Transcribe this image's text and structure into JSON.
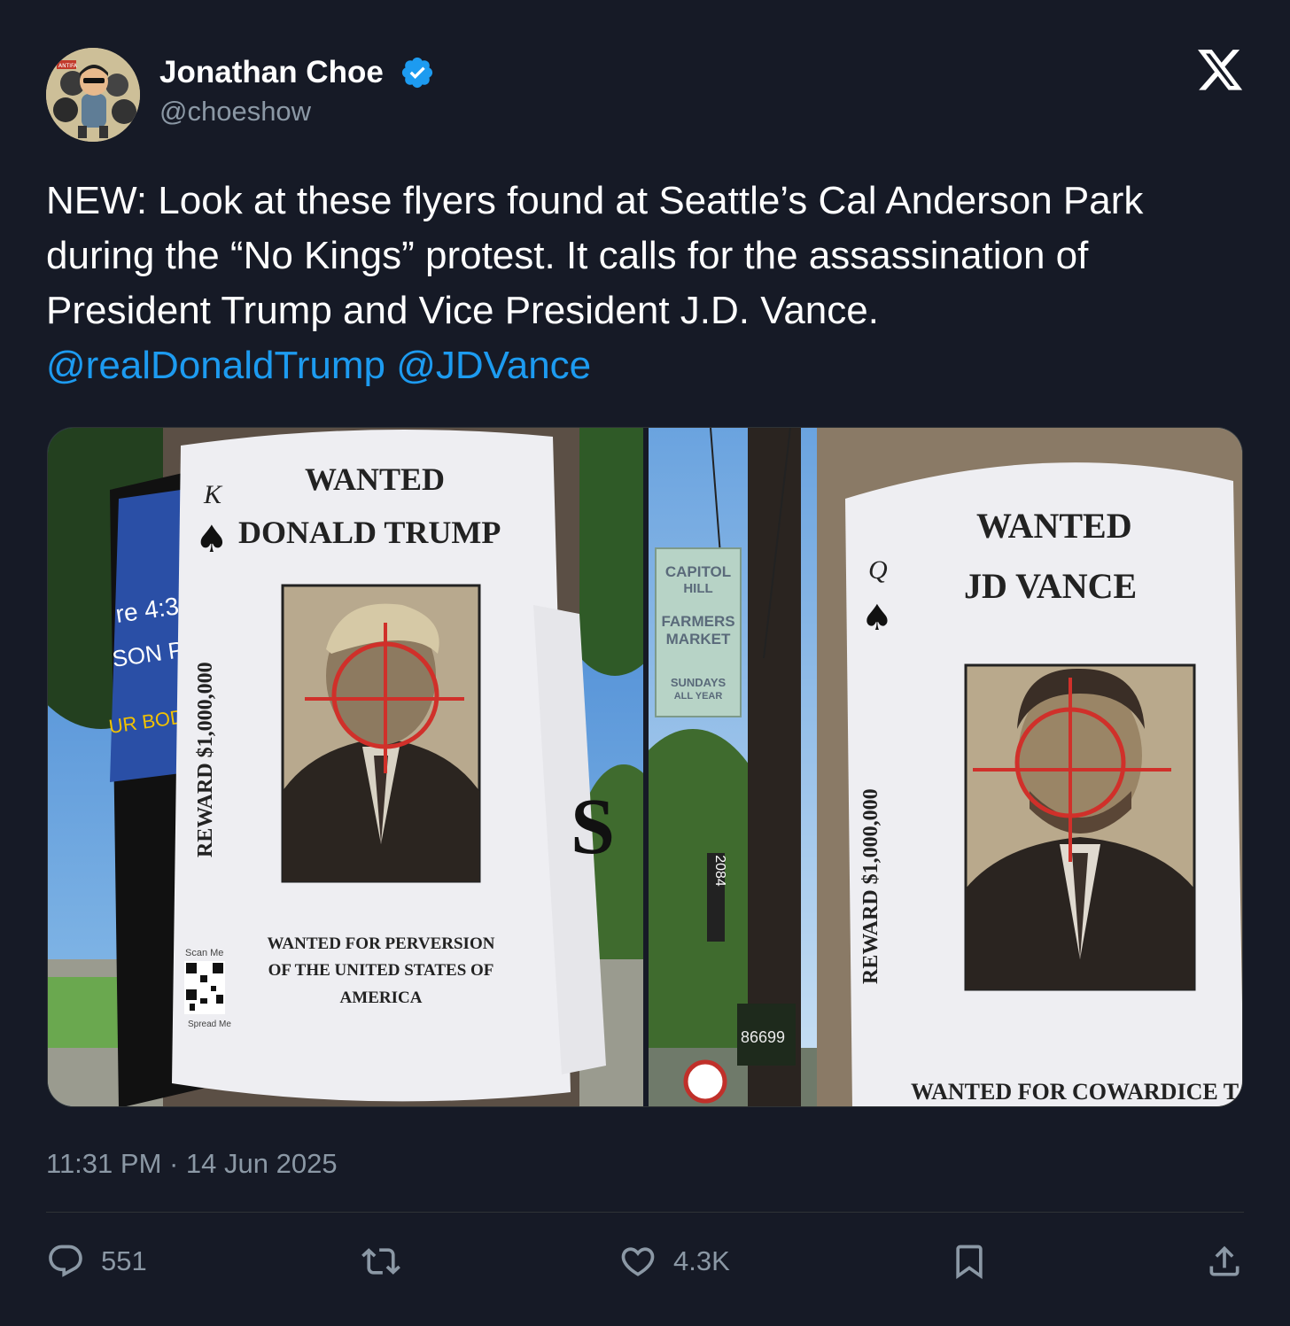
{
  "author": {
    "name": "Jonathan Choe",
    "handle": "@choeshow",
    "verified": true,
    "avatar_icon": "cartoon-avatar"
  },
  "platform_icon": "x-logo",
  "tweet": {
    "text": "NEW: Look at these flyers found at Seattle’s Cal Anderson Park during the “No Kings” protest. It calls for the assassination of President Trump and Vice President J.D. Vance.",
    "mentions": [
      "@realDonaldTrump",
      "@JDVance"
    ]
  },
  "media": {
    "left": {
      "card_rank": "K",
      "title": "WANTED",
      "subject": "DONALD TRUMP",
      "reward": "REWARD $1,000,000",
      "caption_lines": [
        "WANTED FOR PERVERSION",
        "OF THE UNITED STATES OF",
        "AMERICA"
      ],
      "scan_me": "Scan Me",
      "spread_me": "Spread Me"
    },
    "right": {
      "card_rank": "Q",
      "title": "WANTED",
      "subject": "JD VANCE",
      "reward": "REWARD $1,000,000",
      "caption": "WANTED FOR COWARDICE T",
      "sign_lines": [
        "CAPITOL",
        "HILL",
        "FARMERS",
        "MARKET",
        "SUNDAYS",
        "ALL YEAR"
      ],
      "plate": "86699",
      "pole_number": "2084"
    }
  },
  "timestamp": "11:31 PM · 14 Jun 2025",
  "stats": {
    "replies": "551",
    "likes": "4.3K"
  },
  "colors": {
    "background": "#161a26",
    "mention": "#1d9bf0",
    "muted": "#8b98a5",
    "verified": "#1d9bf0"
  }
}
